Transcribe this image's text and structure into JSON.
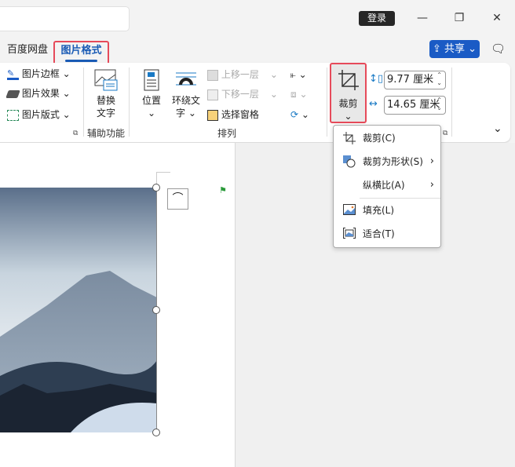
{
  "titlebar": {
    "login": "登录",
    "minimize": "—",
    "restore": "❐",
    "close": "✕"
  },
  "tabs": [
    {
      "label": "百度网盘"
    },
    {
      "label": "图片格式",
      "active": true
    }
  ],
  "share": {
    "label": "共享",
    "chevron": "⌄"
  },
  "ribbon": {
    "style_group": {
      "items": [
        "图片边框",
        "图片效果",
        "图片版式"
      ]
    },
    "accessibility": {
      "alt_text_line1": "替换",
      "alt_text_line2": "文字",
      "group_label": "辅助功能"
    },
    "arrange": {
      "position": "位置",
      "wrap_line1": "环绕文",
      "wrap_line2": "字",
      "bring_forward": "上移一层",
      "send_backward": "下移一层",
      "selection_pane": "选择窗格",
      "group_label": "排列"
    },
    "crop": {
      "label": "裁剪"
    },
    "size": {
      "height": "9.77 厘米",
      "width": "14.65 厘米"
    }
  },
  "crop_menu": {
    "items": [
      {
        "label": "裁剪(C)",
        "icon": "crop-icon"
      },
      {
        "label": "裁剪为形状(S)",
        "icon": "shape-icon",
        "submenu": true
      },
      {
        "label": "纵横比(A)",
        "submenu": true
      },
      {
        "label": "填充(L)",
        "icon": "fill-icon"
      },
      {
        "label": "适合(T)",
        "icon": "fit-icon"
      }
    ]
  },
  "colors": {
    "accent": "#1a5bb5",
    "highlight": "#e64a5a"
  }
}
